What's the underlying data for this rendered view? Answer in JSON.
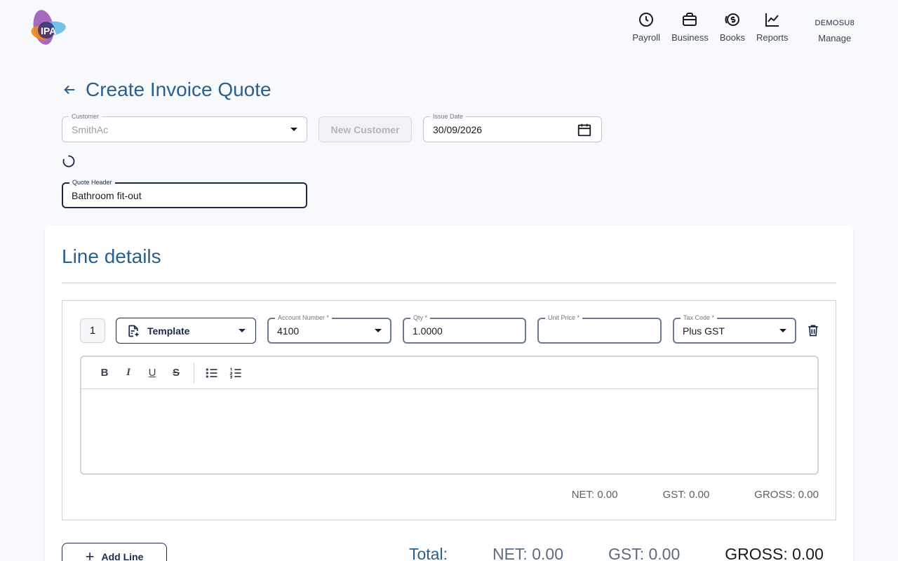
{
  "app": {
    "logo_text": "IPA"
  },
  "nav": {
    "items": [
      {
        "label": "Payroll",
        "icon": "clock-icon"
      },
      {
        "label": "Business",
        "icon": "briefcase-icon"
      },
      {
        "label": "Books",
        "icon": "dollar-coin-icon"
      },
      {
        "label": "Reports",
        "icon": "trend-chart-icon"
      }
    ],
    "user": "DEMOSU8",
    "manage_label": "Manage"
  },
  "page": {
    "title": "Create Invoice Quote"
  },
  "form": {
    "customer": {
      "label": "Customer",
      "value": "SmithAc"
    },
    "new_customer_label": "New Customer",
    "issue_date": {
      "label": "Issue Date",
      "value": "30/09/2026"
    },
    "quote_header": {
      "label": "Quote Header",
      "value": "Bathroom fit-out"
    }
  },
  "line_details": {
    "title": "Line details",
    "lines": [
      {
        "number": "1",
        "template_label": "Template",
        "account_number": {
          "label": "Account Number *",
          "value": "4100"
        },
        "qty": {
          "label": "Qty *",
          "value": "1.0000"
        },
        "unit_price": {
          "label": "Unit Price *",
          "value": ""
        },
        "tax_code": {
          "label": "Tax Code *",
          "value": "Plus GST"
        },
        "editor": {
          "toolbar": {
            "bold": "B",
            "italic": "I",
            "underline": "U",
            "strike": "S"
          },
          "content": ""
        },
        "totals": {
          "net": "NET: 0.00",
          "gst": "GST: 0.00",
          "gross": "GROSS: 0.00"
        }
      }
    ],
    "add_line_label": "Add Line",
    "total": {
      "label": "Total:",
      "net": "NET: 0.00",
      "gst": "GST: 0.00",
      "gross": "GROSS: 0.00"
    }
  },
  "colors": {
    "primary": "#1b2a4a",
    "accent_title": "#2b5f8e",
    "logo_purple": "#7b3fa0",
    "logo_orange": "#f08a1c",
    "logo_blue": "#5bb8e6"
  }
}
